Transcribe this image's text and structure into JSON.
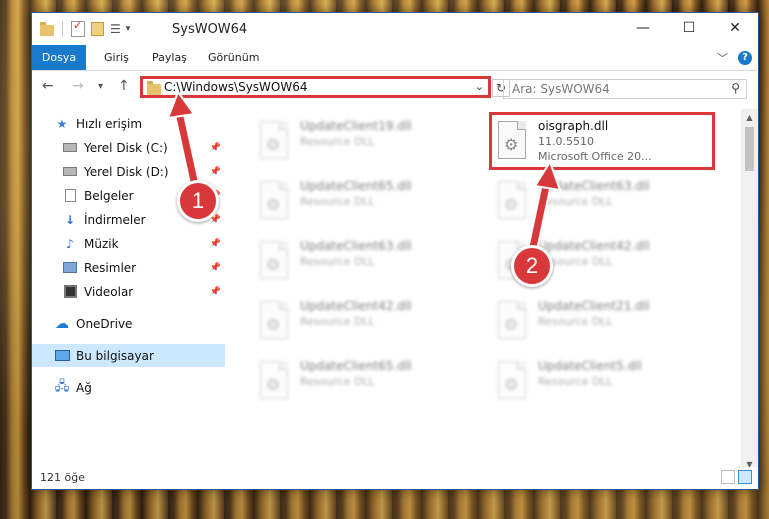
{
  "window": {
    "title": "SysWOW64",
    "minimize": "—",
    "maximize": "☐",
    "close": "✕"
  },
  "ribbon": {
    "tabs": [
      "Dosya",
      "Giriş",
      "Paylaş",
      "Görünüm"
    ]
  },
  "navigation": {
    "address": "C:\\Windows\\SysWOW64",
    "search_placeholder": "Ara: SysWOW64"
  },
  "sidebar": {
    "items": [
      {
        "label": "Hızlı erişim",
        "icon": "star-icon"
      },
      {
        "label": "Yerel Disk (C:)",
        "icon": "disk-icon",
        "pinned": true
      },
      {
        "label": "Yerel Disk (D:)",
        "icon": "disk-icon",
        "pinned": true
      },
      {
        "label": "Belgeler",
        "icon": "documents-icon",
        "pinned": true
      },
      {
        "label": "İndirmeler",
        "icon": "download-icon",
        "pinned": true
      },
      {
        "label": "Müzik",
        "icon": "music-icon",
        "pinned": true
      },
      {
        "label": "Resimler",
        "icon": "pictures-icon",
        "pinned": true
      },
      {
        "label": "Videolar",
        "icon": "videos-icon",
        "pinned": true
      },
      {
        "label": "OneDrive",
        "icon": "onedrive-icon"
      },
      {
        "label": "Bu bilgisayar",
        "icon": "computer-icon",
        "selected": true
      },
      {
        "label": "Ağ",
        "icon": "network-icon"
      }
    ]
  },
  "files": [
    {
      "name": "UpdateClient19.dll",
      "desc": "Resource DLL",
      "blurred": true
    },
    {
      "name": "oisgraph.dll",
      "desc": "11.0.5510",
      "desc2": "Microsoft Office 20...",
      "blurred": false
    },
    {
      "name": "UpdateClient65.dll",
      "desc": "Resource DLL",
      "blurred": true
    },
    {
      "name": "UpdateClient63.dll",
      "desc": "Resource DLL",
      "blurred": true
    },
    {
      "name": "UpdateClient63.dll",
      "desc": "Resource DLL",
      "blurred": true
    },
    {
      "name": "UpdateClient42.dll",
      "desc": "Resource DLL",
      "blurred": true
    },
    {
      "name": "UpdateClient42.dll",
      "desc": "Resource DLL",
      "blurred": true
    },
    {
      "name": "UpdateClient21.dll",
      "desc": "Resource DLL",
      "blurred": true
    },
    {
      "name": "UpdateClient65.dll",
      "desc": "Resource DLL",
      "blurred": true
    },
    {
      "name": "UpdateClient5.dll",
      "desc": "Resource DLL",
      "blurred": true
    }
  ],
  "status": {
    "item_count": "121 öğe"
  },
  "annotations": {
    "badge1": "1",
    "badge2": "2",
    "color": "#d9383a"
  }
}
